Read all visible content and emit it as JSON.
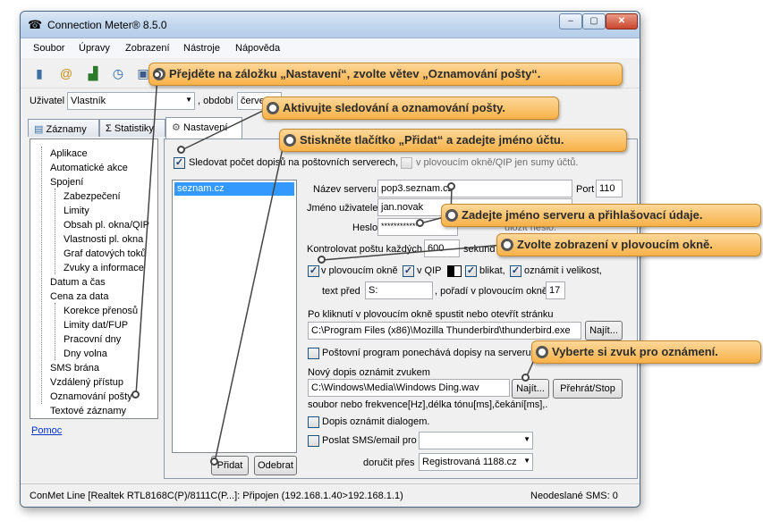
{
  "window": {
    "title": "Connection Meter® 8.5.0",
    "minimize": "–",
    "maximize": "▢",
    "close": "✕",
    "app_icon": "phone-icon"
  },
  "menu": [
    "Soubor",
    "Úpravy",
    "Zobrazení",
    "Nástroje",
    "Nápověda"
  ],
  "toolbar_icons": [
    "phone-icon",
    "mail-icon",
    "chart-icon",
    "clock-icon",
    "save-icon"
  ],
  "userrow": {
    "user_label": "Uživatel",
    "user_value": "Vlastník",
    "period_label": ", období",
    "period_value": "červen"
  },
  "tabs": [
    "Záznamy",
    "Statistiky",
    "Nastavení"
  ],
  "tree": {
    "aplikace": "Aplikace",
    "automaticke": "Automatické akce",
    "spojeni": "Spojení",
    "zabezpeceni": "Zabezpečení",
    "limity": "Limity",
    "obsah": "Obsah pl. okna/QIP",
    "vlastnosti": "Vlastnosti pl. okna",
    "graf": "Graf datových toků",
    "zvuky": "Zvuky a informace",
    "datum": "Datum a čas",
    "cena": "Cena za data",
    "korekce": "Korekce přenosů",
    "limity_fup": "Limity dat/FUP",
    "pracovni": "Pracovní dny",
    "volna": "Dny volna",
    "sms": "SMS brána",
    "vzdaleny": "Vzdálený přístup",
    "oznamovani": "Oznamování pošty",
    "textove": "Textové záznamy"
  },
  "help_link": "Pomoc",
  "settings": {
    "track_label": "Sledovat počet dopisů na poštovních serverech,",
    "track_checked": "✓",
    "sum_label": "v plovoucím okně/QIP jen sumy účtů.",
    "accounts": [
      "seznam.cz"
    ],
    "server_label": "Název serveru",
    "server_value": "pop3.seznam.cz",
    "port_label": "Port",
    "port_value": "110",
    "user_label": "Jméno uživatele",
    "user_value": "jan.novak",
    "pass_label": "Heslo",
    "pass_value": "*************",
    "pass_partial": "uložit heslo.",
    "check_label": "Kontrolovat poštu každých",
    "check_value": "600",
    "check_unit": "sekund",
    "float_label": "v plovoucím okně",
    "qip_label": "v QIP",
    "blink_label": "blikat,",
    "size_label": "oznámit i velikost,",
    "text_before_label": "text před",
    "text_before_value": "S:",
    "order_label": ", pořadí v plovoucím okně",
    "order_value": "17",
    "click_label": "Po kliknutí v plovoucím okně spustit nebo otevřít stránku",
    "click_value": "C:\\Program Files (x86)\\Mozilla Thunderbird\\thunderbird.exe",
    "find_label": "Najít...",
    "keep_label": "Poštovní program ponechává dopisy na serveru.",
    "sound_label": "Nový dopis oznámit zvukem",
    "sound_value": "C:\\Windows\\Media\\Windows Ding.wav",
    "play_label": "Přehrát/Stop",
    "sound_hint": "soubor nebo frekvence[Hz],délka tónu[ms],čekání[ms],...",
    "dialog_label": "Dopis oznámit dialogem.",
    "sms_label": "Poslat SMS/email pro",
    "deliver_label": "doručit přes",
    "deliver_value": "Registrovaná 1188.cz",
    "add_label": "Přidat",
    "remove_label": "Odebrat"
  },
  "status": {
    "left": "ConMet Line [Realtek RTL8168C(P)/8111C(P...]: Připojen (192.168.1.40>192.168.1.1)",
    "right": "Neodeslané SMS: 0"
  },
  "callouts": [
    "Přejděte na záložku „Nastavení“, zvolte větev „Oznamování pošty“.",
    "Aktivujte sledování a oznamování pošty.",
    "Stiskněte tlačítko „Přidat“ a zadejte jméno účtu.",
    "Zadejte jméno serveru a přihlašovací údaje.",
    "Zvolte zobrazení v plovoucím okně.",
    "Vyberte si zvuk pro oznámení."
  ]
}
